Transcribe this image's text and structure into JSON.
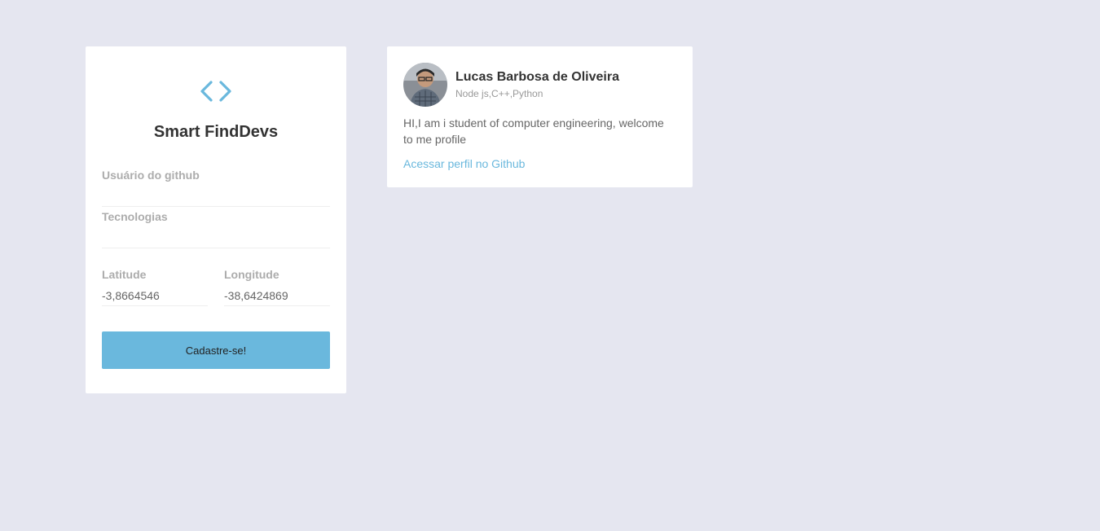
{
  "form": {
    "title": "Smart FindDevs",
    "logo_icon": "code-brackets-icon",
    "github_user": {
      "label": "Usuário do github",
      "value": ""
    },
    "techs": {
      "label": "Tecnologias",
      "value": ""
    },
    "latitude": {
      "label": "Latitude",
      "value": "-3,8664546"
    },
    "longitude": {
      "label": "Longitude",
      "value": "-38,6424869"
    },
    "submit_label": "Cadastre-se!"
  },
  "dev": {
    "name": "Lucas Barbosa de Oliveira",
    "techs": "Node js,C++,Python",
    "bio": "HI,I am i student of computer engineering, welcome to me profile",
    "link_label": "Acessar perfil no Github"
  },
  "colors": {
    "background": "#e5e6f0",
    "accent": "#6ab8dd",
    "card": "#ffffff"
  }
}
